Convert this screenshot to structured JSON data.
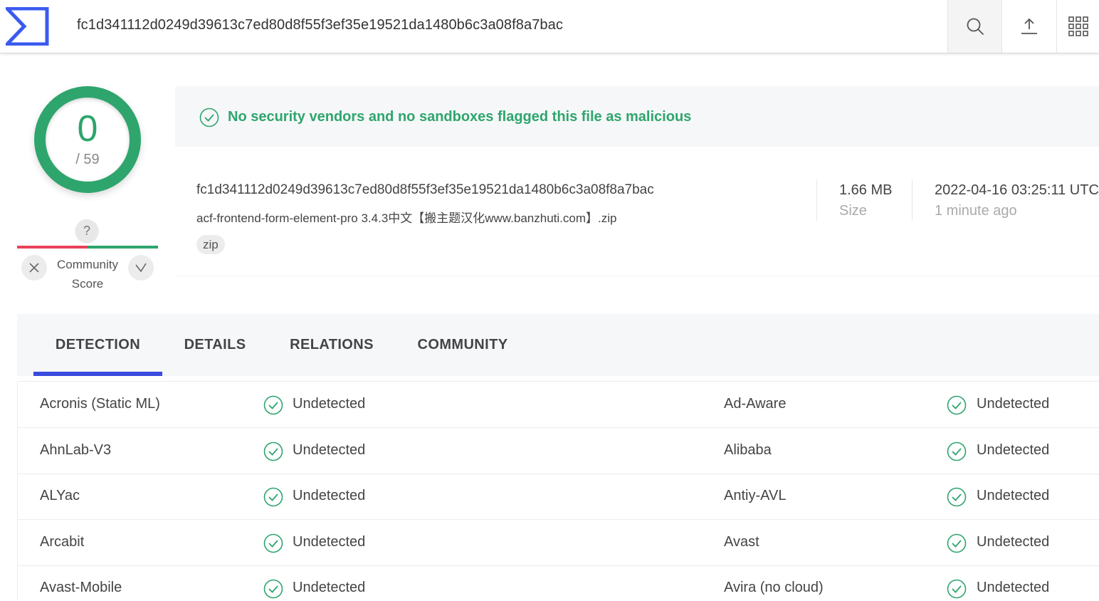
{
  "topbar": {
    "search_value": "fc1d341112d0249d39613c7ed80d8f55f3ef35e19521da1480b6c3a08f8a7bac"
  },
  "score": {
    "positives": "0",
    "total": "/ 59",
    "ring_color": "#2ea56d"
  },
  "community": {
    "question": "?",
    "label_line1": "Community",
    "label_line2": "Score"
  },
  "banner": {
    "message": "No security vendors and no sandboxes flagged this file as malicious",
    "color": "#2ea56d"
  },
  "file": {
    "hash": "fc1d341112d0249d39613c7ed80d8f55f3ef35e19521da1480b6c3a08f8a7bac",
    "name": "acf-frontend-form-element-pro 3.4.3中文【搬主题汉化www.banzhuti.com】.zip",
    "tag": "zip",
    "size_value": "1.66 MB",
    "size_label": "Size",
    "date_value": "2022-04-16 03:25:11 UTC",
    "date_ago": "1 minute ago"
  },
  "tabs": [
    {
      "label": "DETECTION",
      "active": true
    },
    {
      "label": "DETAILS",
      "active": false
    },
    {
      "label": "RELATIONS",
      "active": false
    },
    {
      "label": "COMMUNITY",
      "active": false
    }
  ],
  "accent_color": "#3a4bde",
  "detections": [
    {
      "left": {
        "vendor": "Acronis (Static ML)",
        "result": "Undetected"
      },
      "right": {
        "vendor": "Ad-Aware",
        "result": "Undetected"
      }
    },
    {
      "left": {
        "vendor": "AhnLab-V3",
        "result": "Undetected"
      },
      "right": {
        "vendor": "Alibaba",
        "result": "Undetected"
      }
    },
    {
      "left": {
        "vendor": "ALYac",
        "result": "Undetected"
      },
      "right": {
        "vendor": "Antiy-AVL",
        "result": "Undetected"
      }
    },
    {
      "left": {
        "vendor": "Arcabit",
        "result": "Undetected"
      },
      "right": {
        "vendor": "Avast",
        "result": "Undetected"
      }
    },
    {
      "left": {
        "vendor": "Avast-Mobile",
        "result": "Undetected"
      },
      "right": {
        "vendor": "Avira (no cloud)",
        "result": "Undetected"
      }
    }
  ]
}
